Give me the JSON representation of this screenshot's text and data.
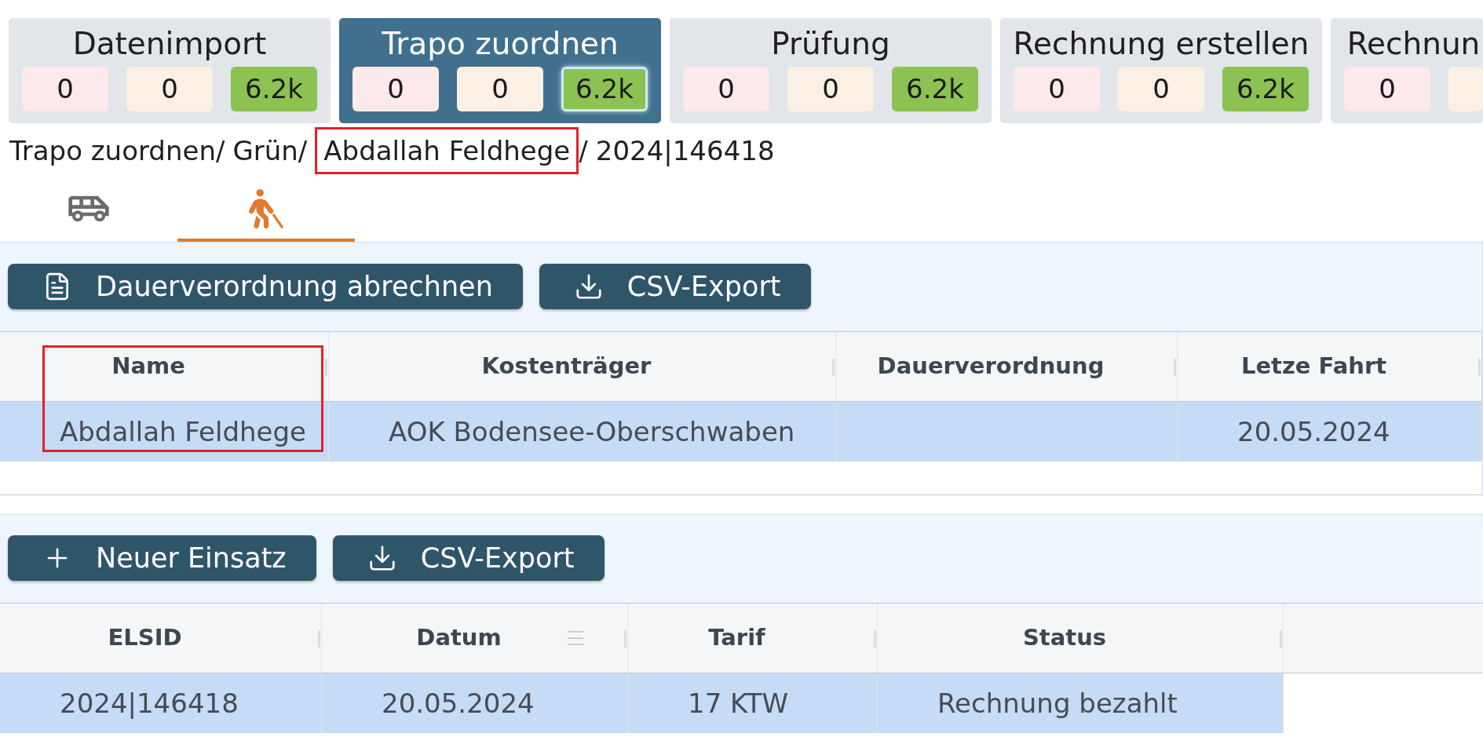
{
  "stages": [
    {
      "title": "Datenimport",
      "selected": false,
      "counts": [
        {
          "kind": "error",
          "value": "0",
          "selected": false
        },
        {
          "kind": "warning",
          "value": "0",
          "selected": false
        },
        {
          "kind": "ok",
          "value": "6.2k",
          "selected": false
        }
      ]
    },
    {
      "title": "Trapo zuordnen",
      "selected": true,
      "counts": [
        {
          "kind": "error",
          "value": "0",
          "selected": false
        },
        {
          "kind": "warning",
          "value": "0",
          "selected": false
        },
        {
          "kind": "ok",
          "value": "6.2k",
          "selected": true
        }
      ]
    },
    {
      "title": "Prüfung",
      "selected": false,
      "counts": [
        {
          "kind": "error",
          "value": "0",
          "selected": false
        },
        {
          "kind": "warning",
          "value": "0",
          "selected": false
        },
        {
          "kind": "ok",
          "value": "6.2k",
          "selected": false
        }
      ]
    },
    {
      "title": "Rechnung erstellen",
      "selected": false,
      "counts": [
        {
          "kind": "error",
          "value": "0",
          "selected": false
        },
        {
          "kind": "warning",
          "value": "0",
          "selected": false
        },
        {
          "kind": "ok",
          "value": "6.2k",
          "selected": false
        }
      ]
    },
    {
      "title": "Rechnun",
      "selected": false,
      "counts": [
        {
          "kind": "error",
          "value": "0",
          "selected": false
        },
        {
          "kind": "warning",
          "selected": false
        }
      ]
    }
  ],
  "breadcrumb": [
    {
      "label": "Trapo zuordnen",
      "separator": "/",
      "marked": false
    },
    {
      "label": "Grün",
      "separator": "/",
      "marked": false
    },
    {
      "label": "Abdallah Feldhege",
      "separator": "/",
      "marked": true
    },
    {
      "label": "2024|146418",
      "marked": false
    }
  ],
  "tabs": [
    {
      "kind": "vehicle",
      "selected": false
    },
    {
      "kind": "patient",
      "selected": true
    }
  ],
  "patient_panel": {
    "toolbar": [
      {
        "kind": "document",
        "label": "Dauerverordnung abrechnen"
      },
      {
        "kind": "download",
        "label": "CSV-Export"
      }
    ],
    "table": {
      "columns": [
        {
          "label": "Name",
          "marked": true
        },
        {
          "label": "Kostenträger",
          "marked": false
        },
        {
          "label": "Dauerverordnung",
          "marked": false
        },
        {
          "label": "Letze Fahrt",
          "marked": false
        }
      ],
      "rows": [
        {
          "selected": true,
          "cells": [
            "Abdallah Feldhege",
            "AOK Bodensee-Oberschwaben",
            null,
            "20.05.2024"
          ]
        }
      ]
    }
  },
  "mission_panel": {
    "toolbar": [
      {
        "kind": "add",
        "label": "Neuer Einsatz"
      },
      {
        "kind": "download",
        "label": "CSV-Export"
      }
    ],
    "table": {
      "columns": [
        {
          "label": "ELSID",
          "menu": false
        },
        {
          "label": "Datum",
          "menu": true
        },
        {
          "label": "Tarif",
          "menu": false
        },
        {
          "label": "Status",
          "menu": false
        }
      ],
      "rows": [
        {
          "selected": true,
          "cells": [
            "2024|146418",
            "20.05.2024",
            "17 KTW",
            "Rechnung bezahlt"
          ]
        }
      ]
    }
  }
}
